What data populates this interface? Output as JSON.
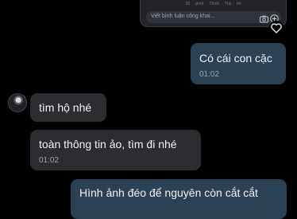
{
  "embed": {
    "meta": [
      "29 phút",
      "Thích",
      "Trả lời"
    ],
    "comment_placeholder": "Viết bình luận công khai...",
    "icons": [
      "camera-icon",
      "add-icon"
    ]
  },
  "reaction_icon": "heart-outline-icon",
  "messages": [
    {
      "side": "out",
      "text": "Có cái con cặc",
      "time": "01:02"
    },
    {
      "side": "in",
      "text": "tìm hộ nhé"
    },
    {
      "side": "in",
      "text": "toàn thông tin ảo, tìm đi nhé",
      "time": "01:02"
    },
    {
      "side": "out",
      "text": "Hình ảnh đéo để nguyên còn cắt cắt"
    }
  ],
  "colors": {
    "outgoing_bubble": "#2b4156",
    "incoming_bubble": "#2b2d31",
    "background": "#000000"
  }
}
